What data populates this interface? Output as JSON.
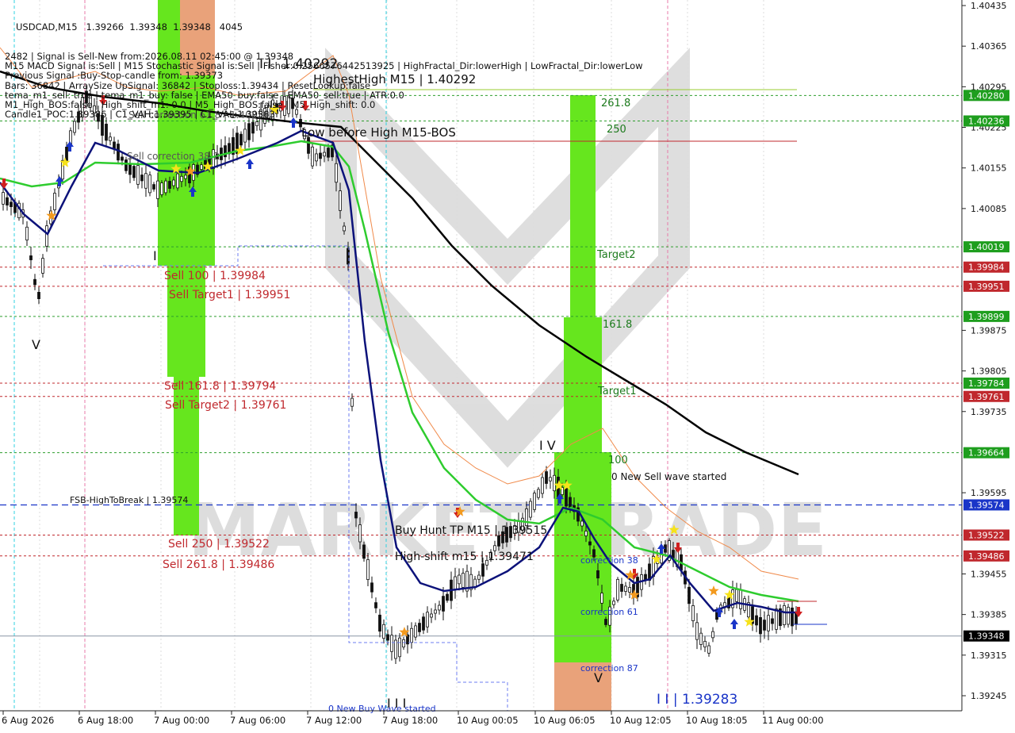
{
  "symbol_header": "USDCAD,M15",
  "info_lines": [
    "2482 | Signal is Sell-New from:2026.08.11 02:45:00 @ 1.39348",
    "M15 MACD Signal is:Sell | M15 Stochastic Signal is:Sell | Fisher:0.2566576442513925 | HighFractal_Dir:lowerHigh | LowFractal_Dir:lowerLow",
    "Previous Signal :Buy-Stop-candle from: 1.39373",
    "Bars: 36842 | ArraySize UpSignal: 36842 | Stoploss:1.39434 | ResetLookup:false",
    "tema_m1_sell: true | tema_m1_buy: false | EMA50_buy:false | EMA50_sell:true | ATR:0.0",
    "M1_High_BOS:false | High_shift_m1: 0.0 | M5_High_BOS:false | M5_High_shift: 0.0",
    "Candle1_POC:1.39386 | C1_VAH:1.39395 | C1_VAL:1.39383"
  ],
  "header_overlap": "1.39266  1.39348  1.39348   4045",
  "price_axis": {
    "ticks": [
      "1.40435",
      "1.40365",
      "1.40295",
      "1.40225",
      "1.40155",
      "1.40085",
      "1.39875",
      "1.39805",
      "1.39735",
      "1.39595",
      "1.39455",
      "1.39385",
      "1.39315",
      "1.39245"
    ],
    "badges": [
      {
        "label": "1.40280",
        "color": "#1e9e1e"
      },
      {
        "label": "1.40236",
        "color": "#1e9e1e"
      },
      {
        "label": "1.40019",
        "color": "#1e9e1e"
      },
      {
        "label": "1.39984",
        "color": "#c0282d"
      },
      {
        "label": "1.39951",
        "color": "#c0282d"
      },
      {
        "label": "1.39899",
        "color": "#1e9e1e"
      },
      {
        "label": "1.39784",
        "color": "#1e9e1e"
      },
      {
        "label": "1.39761",
        "color": "#c0282d"
      },
      {
        "label": "1.39664",
        "color": "#1e9e1e"
      },
      {
        "label": "1.39574",
        "color": "#1a35c8"
      },
      {
        "label": "1.39522",
        "color": "#c0282d"
      },
      {
        "label": "1.39486",
        "color": "#c0282d"
      },
      {
        "label": "1.39348",
        "color": "#000000"
      }
    ]
  },
  "time_axis": [
    "6 Aug 2026",
    "6 Aug 18:00",
    "7 Aug 00:00",
    "7 Aug 06:00",
    "7 Aug 12:00",
    "7 Aug 18:00",
    "10 Aug 00:05",
    "10 Aug 06:05",
    "10 Aug 12:05",
    "10 Aug 18:05",
    "11 Aug 00:00"
  ],
  "annotations": {
    "highest_high": "HighestHigh   M15 | 1.40292",
    "highest_high_top": "1.40292",
    "low_before_high": "Low before High   M15-BOS",
    "sell_correction_618": "Sell correction 61.8 | 1.40259",
    "sell_correction_382": "Sell correction 38.2",
    "sell_100": "Sell 100 | 1.39984",
    "sell_target1": "Sell Target1 | 1.39951",
    "sell_1618": "Sell 161.8 | 1.39794",
    "sell_target2": "Sell Target2 | 1.39761",
    "fsb": "FSB-HighToBreak | 1.39574",
    "sell_250": "Sell  250 | 1.39522",
    "sell_2618": "Sell  261.8 | 1.39486",
    "buy_hunt": "Buy Hunt TP M15 | 1.39515",
    "high_shift": "High-shift m15 | 1.39471",
    "fib_2618": "261.8",
    "fib_250": "250",
    "target2": "Target2",
    "fib_1618": "161.8",
    "target1": "Target1",
    "fib_100": "100",
    "new_sell_wave": "0 New Sell wave started",
    "new_buy_wave": "0 New Buy Wave started",
    "correction_38": "correction 38",
    "correction_61": "correction 61",
    "correction_87": "correction 87",
    "low_label": "I I | 1.39283",
    "wave_iv": "I V",
    "wave_v_left": "V",
    "wave_v_right": "V",
    "wave_i": "I",
    "wave_iii": "I I I",
    "wave_ii": "I I"
  },
  "watermark": "MARKET TRADE",
  "colors": {
    "green_zone": "#66e61e",
    "orange_zone": "#e9a27a",
    "ema_green": "#2ecc2e",
    "navy_line": "#0c127a",
    "black_ma": "#000000",
    "sell_red": "#c0282d",
    "fsb_blue": "#1a35c8"
  }
}
